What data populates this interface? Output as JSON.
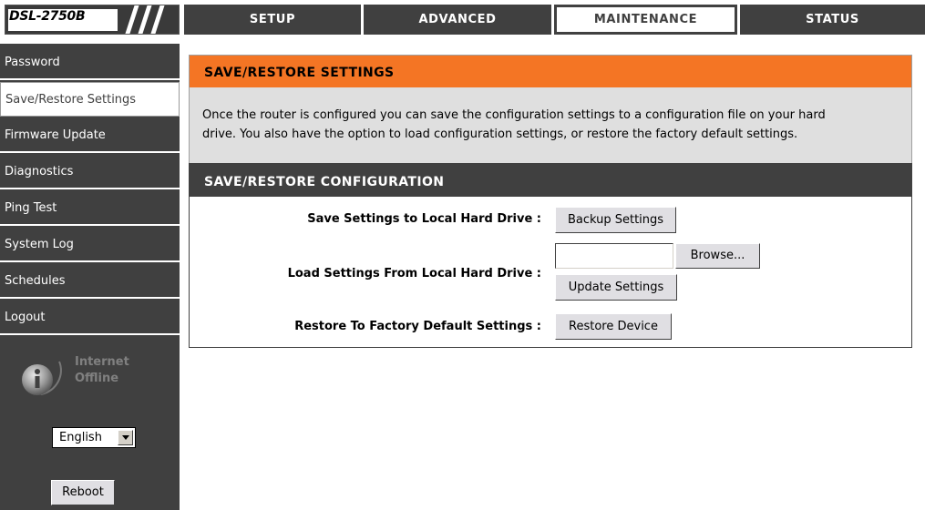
{
  "header": {
    "model": "DSL-2750B",
    "tabs": [
      "SETUP",
      "ADVANCED",
      "MAINTENANCE",
      "STATUS"
    ],
    "active_tab": "MAINTENANCE"
  },
  "sidebar": {
    "items": [
      {
        "label": "Password"
      },
      {
        "label": "Save/Restore Settings"
      },
      {
        "label": "Firmware Update"
      },
      {
        "label": "Diagnostics"
      },
      {
        "label": "Ping Test"
      },
      {
        "label": "System Log"
      },
      {
        "label": "Schedules"
      },
      {
        "label": "Logout"
      }
    ],
    "active_item": "Save/Restore Settings",
    "internet_status_line1": "Internet",
    "internet_status_line2": "Offline",
    "language": "English",
    "reboot_label": "Reboot"
  },
  "intro": {
    "title": "SAVE/RESTORE SETTINGS",
    "text_line1": "Once the router is configured you can save the configuration settings to a configuration file on your hard",
    "text_line2": "drive. You also have the option to load configuration settings, or restore the factory default settings."
  },
  "config": {
    "title": "SAVE/RESTORE CONFIGURATION",
    "save_label": "Save Settings to Local Hard Drive :",
    "backup_button": "Backup Settings",
    "load_label": "Load Settings From Local Hard Drive :",
    "file_value": "",
    "browse_button": "Browse...",
    "update_button": "Update Settings",
    "restore_label": "Restore To Factory Default Settings :",
    "restore_button": "Restore Device"
  },
  "colors": {
    "dark_bar": "#404040",
    "orange_header": "#f47524",
    "panel_bg": "#dfdfdf",
    "button_bg": "#e0dfe3"
  },
  "icons": [
    "info-offline-icon",
    "dropdown-arrow-icon"
  ]
}
